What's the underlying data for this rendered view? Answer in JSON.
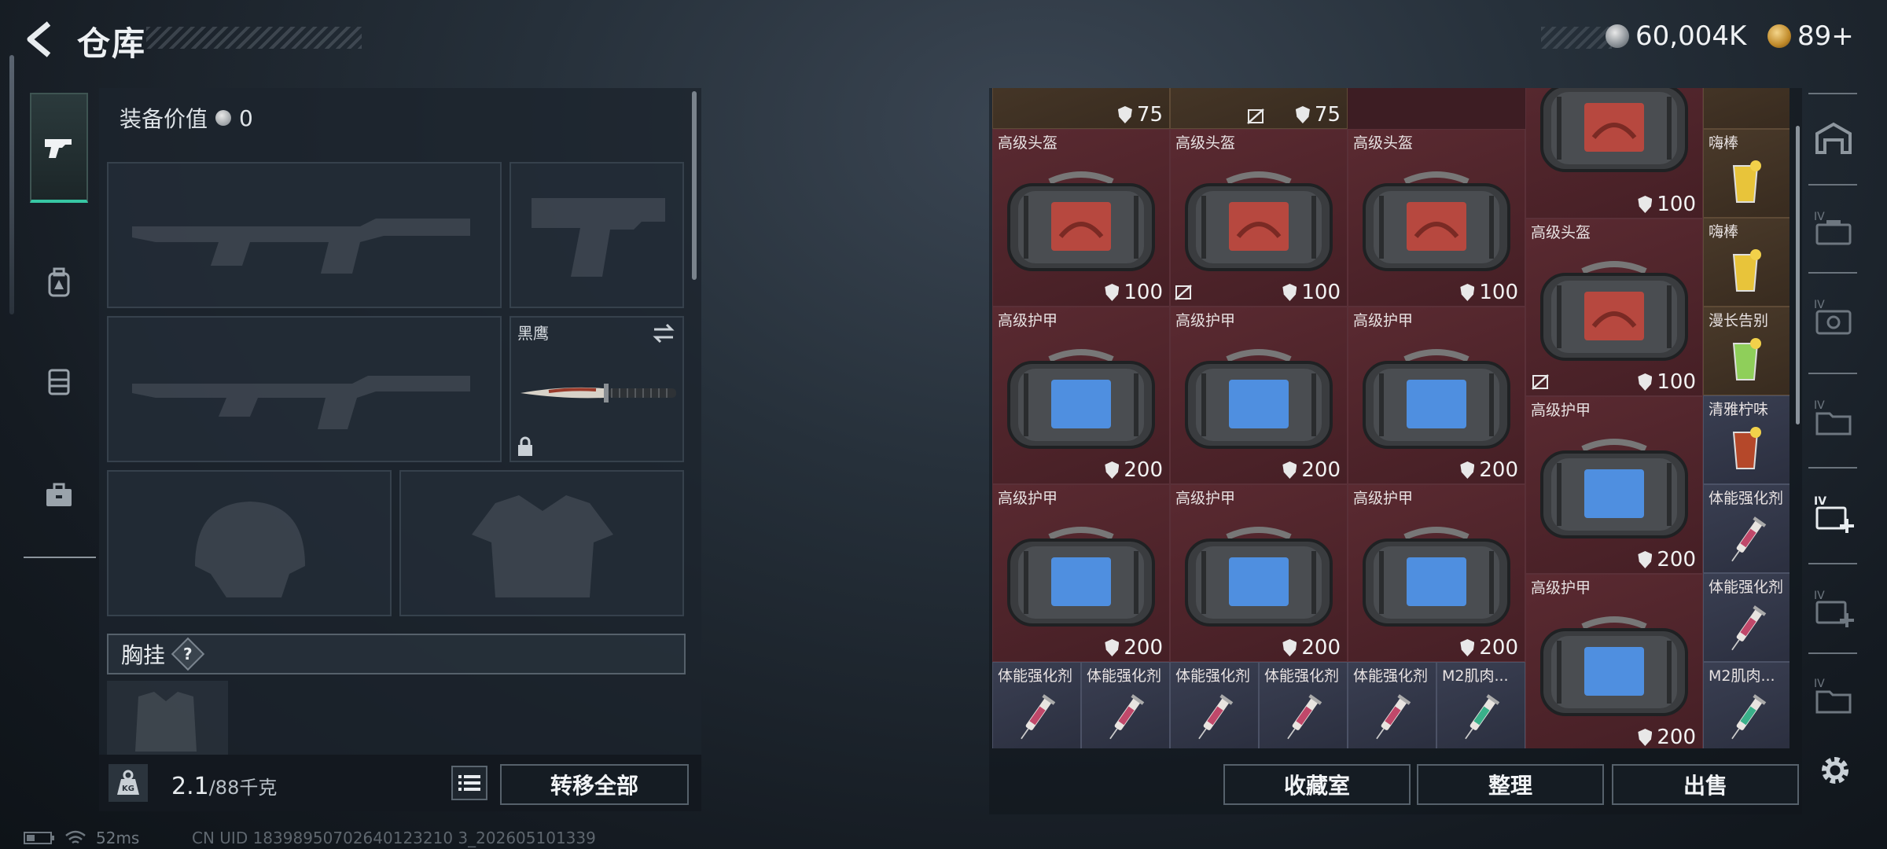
{
  "header": {
    "title": "仓库",
    "currency_coin": "60,004K",
    "currency_token": "89+"
  },
  "left_rail": {
    "tabs": [
      {
        "icon": "pistol-icon",
        "active": true
      },
      {
        "icon": "backpack-icon"
      },
      {
        "icon": "vest-icon"
      },
      {
        "icon": "case-icon"
      }
    ]
  },
  "loadout": {
    "equipment_value_label": "装备价值",
    "equipment_value": "0",
    "melee": {
      "name": "黑鹰"
    },
    "chest_rig_label": "胸挂",
    "chest_rig_help": "?",
    "weight_current": "2.1",
    "weight_max": "/88千克",
    "transfer_all": "转移全部"
  },
  "inventory": {
    "top_partial": [
      {
        "durability": "75"
      },
      {
        "durability": "75"
      }
    ],
    "helmets": [
      {
        "name": "高级头盔",
        "durability": "100"
      },
      {
        "name": "高级头盔",
        "durability": "100"
      },
      {
        "name": "高级头盔",
        "durability": "100"
      }
    ],
    "armor_row1": [
      {
        "name": "高级护甲",
        "durability": "200"
      },
      {
        "name": "高级护甲",
        "durability": "200"
      },
      {
        "name": "高级护甲",
        "durability": "200"
      }
    ],
    "armor_row2": [
      {
        "name": "高级护甲",
        "durability": "200"
      },
      {
        "name": "高级护甲",
        "durability": "200"
      },
      {
        "name": "高级护甲",
        "durability": "200"
      }
    ],
    "small_row": [
      "体能强化剂",
      "体能强化剂",
      "体能强化剂",
      "体能强化剂",
      "体能强化剂",
      "M2肌肉..."
    ],
    "col4": [
      {
        "name": "",
        "durability": "100"
      },
      {
        "name": "高级头盔",
        "durability": "100"
      },
      {
        "name": "高级护甲",
        "durability": "200"
      },
      {
        "name": "高级护甲",
        "durability": "200"
      }
    ],
    "col5": [
      "嗨棒",
      "嗨棒",
      "漫长告别",
      "清雅柠味",
      "体能强化剂",
      "体能强化剂",
      "M2肌肉..."
    ]
  },
  "actions": {
    "collection": "收藏室",
    "sort": "整理",
    "sell": "出售"
  },
  "status": {
    "ping": "52ms",
    "uid": "CN UID 18398950702640123210 3_202605101339"
  }
}
